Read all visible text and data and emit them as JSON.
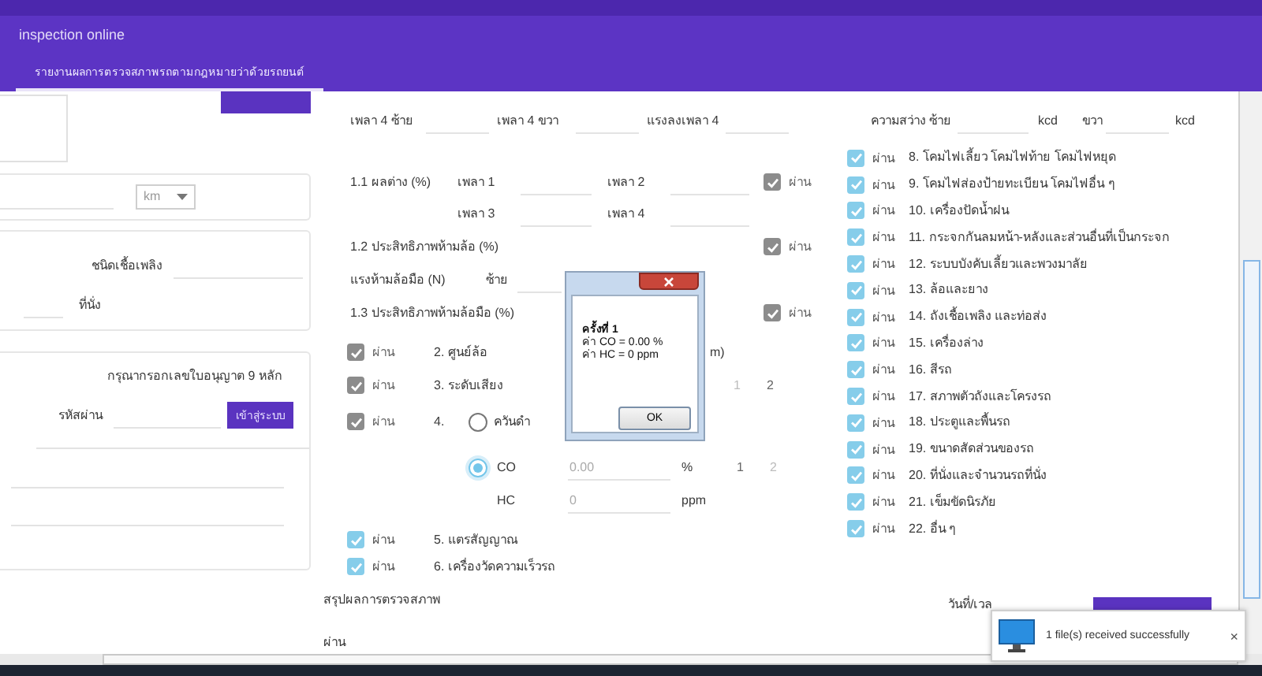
{
  "window": {
    "title": "inspection online"
  },
  "tabs": [
    {
      "label": "รายงานผลการตรวจสภาพรถตามกฎหมายว่าด้วยรถยนต์",
      "selected": true
    }
  ],
  "left_panel": {
    "unit_select": {
      "value": "km"
    },
    "fuel_label": "ชนิดเชื้อเพลิง",
    "seats_label": "ที่นั่ง",
    "login": {
      "prompt": "กรุณากรอกเลขใบอนุญาต 9 หลัก",
      "password_label": "รหัสผ่าน",
      "button": "เข้าสู่ระบบ"
    }
  },
  "axle_row": [
    "เพลา 4 ซ้าย",
    "เพลา 4 ขวา",
    "แรงลงเพลา 4"
  ],
  "brake_difference": {
    "label": "1.1 ผลต่าง (%)",
    "axles": [
      "เพลา 1",
      "เพลา 2",
      "เพลา 3",
      "เพลา 4"
    ],
    "check": {
      "label": "ผ่าน",
      "checked": true,
      "disabled": true
    }
  },
  "brake_efficiency": {
    "label": "1.2 ประสิทธิภาพห้ามล้อ (%)",
    "check": {
      "label": "ผ่าน",
      "checked": true,
      "disabled": true
    }
  },
  "handbrake_force": {
    "label": "แรงห้ามล้อมือ (N)",
    "side": "ซ้าย"
  },
  "handbrake_efficiency": {
    "label": "1.3 ประสิทธิภาพห้ามล้อมือ (%)",
    "check": {
      "label": "ผ่าน",
      "checked": true,
      "disabled": true
    }
  },
  "tests": [
    {
      "kind": "wheel",
      "check": {
        "label": "ผ่าน",
        "checked": true,
        "disabled": true
      },
      "label": "2. ศูนย์ล้อ",
      "unit": "m)"
    },
    {
      "kind": "noise",
      "check": {
        "label": "ผ่าน",
        "checked": true,
        "disabled": true
      },
      "label": "3. ระดับเสียง",
      "readings": [
        {
          "label": "1",
          "disabled": true
        },
        {
          "label": "2",
          "disabled": false
        }
      ]
    },
    {
      "kind": "emission",
      "check": {
        "label": "ผ่าน",
        "checked": true,
        "disabled": true
      },
      "label": "4.",
      "options": [
        {
          "label": "ควันดำ",
          "selected": false
        },
        {
          "label": "CO",
          "selected": true
        }
      ],
      "co": {
        "value": "0.00",
        "unit": "%",
        "readings": [
          {
            "label": "1",
            "disabled": false
          },
          {
            "label": "2",
            "disabled": true
          }
        ]
      },
      "hc": {
        "label": "HC",
        "value": "0",
        "unit": "ppm"
      }
    },
    {
      "kind": "plain",
      "check": {
        "label": "ผ่าน",
        "checked": true,
        "disabled": false
      },
      "label": "5. แตรสัญญาณ"
    },
    {
      "kind": "plain",
      "check": {
        "label": "ผ่าน",
        "checked": true,
        "disabled": false
      },
      "label": "6. เครื่องวัดความเร็วรถ"
    }
  ],
  "summary": {
    "label": "สรุปผลการตรวจสภาพ",
    "result": "ผ่าน"
  },
  "lights": {
    "label": "ความสว่าง ซ้าย",
    "left_unit": "kcd",
    "right_label": "ขวา",
    "right_unit": "kcd"
  },
  "checklist": [
    {
      "label": "8. โคมไฟเลี้ยว โคมไฟท้าย โคมไฟหยุด",
      "check": {
        "label": "ผ่าน",
        "checked": true,
        "disabled": false
      }
    },
    {
      "label": "9. โคมไฟส่องป้ายทะเบียน โคมไฟอื่น ๆ",
      "check": {
        "label": "ผ่าน",
        "checked": true,
        "disabled": false
      }
    },
    {
      "label": "10. เครื่องปัดน้ำฝน",
      "check": {
        "label": "ผ่าน",
        "checked": true,
        "disabled": false
      }
    },
    {
      "label": "11. กระจกกันลมหน้า-หลังและส่วนอื่นที่เป็นกระจก",
      "check": {
        "label": "ผ่าน",
        "checked": true,
        "disabled": false
      }
    },
    {
      "label": "12. ระบบบังคับเลี้ยวและพวงมาลัย",
      "check": {
        "label": "ผ่าน",
        "checked": true,
        "disabled": false
      }
    },
    {
      "label": "13. ล้อและยาง",
      "check": {
        "label": "ผ่าน",
        "checked": true,
        "disabled": false
      }
    },
    {
      "label": "14. ถังเชื้อเพลิง และท่อส่ง",
      "check": {
        "label": "ผ่าน",
        "checked": true,
        "disabled": false
      }
    },
    {
      "label": "15. เครื่องล่าง",
      "check": {
        "label": "ผ่าน",
        "checked": true,
        "disabled": false
      }
    },
    {
      "label": "16. สีรถ",
      "check": {
        "label": "ผ่าน",
        "checked": true,
        "disabled": false
      }
    },
    {
      "label": "17. สภาพตัวถังและโครงรถ",
      "check": {
        "label": "ผ่าน",
        "checked": true,
        "disabled": false
      }
    },
    {
      "label": "18. ประตูและพื้นรถ",
      "check": {
        "label": "ผ่าน",
        "checked": true,
        "disabled": false
      }
    },
    {
      "label": "19. ขนาดสัดส่วนของรถ",
      "check": {
        "label": "ผ่าน",
        "checked": true,
        "disabled": false
      }
    },
    {
      "label": "20. ที่นั่งและจำนวนรถที่นั่ง",
      "check": {
        "label": "ผ่าน",
        "checked": true,
        "disabled": false
      }
    },
    {
      "label": "21. เข็มขัดนิรภัย",
      "check": {
        "label": "ผ่าน",
        "checked": true,
        "disabled": false
      }
    },
    {
      "label": "22. อื่น ๆ",
      "check": {
        "label": "ผ่าน",
        "checked": true,
        "disabled": false
      }
    }
  ],
  "date_label": "วันที่/เวล",
  "dialog": {
    "heading": "ครั้งที่ 1",
    "lines": [
      "ค่า CO = 0.00 %",
      "ค่า HC = 0 ppm"
    ],
    "button": "OK"
  },
  "notification": {
    "message": "1 file(s) received successfully",
    "close": "×"
  }
}
